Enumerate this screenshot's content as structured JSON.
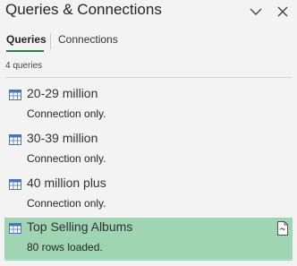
{
  "header": {
    "title": "Queries & Connections",
    "chevron_icon": "chevron-down-icon",
    "close_icon": "close-icon"
  },
  "tabs": [
    {
      "label": "Queries",
      "active": true
    },
    {
      "label": "Connections",
      "active": false
    }
  ],
  "query_count": "4 queries",
  "queries": [
    {
      "name": "20-29 million",
      "status": "Connection only.",
      "icon": "table-icon",
      "selected": false
    },
    {
      "name": "30-39 million",
      "status": "Connection only.",
      "icon": "table-icon",
      "selected": false
    },
    {
      "name": "40 million plus",
      "status": "Connection only.",
      "icon": "table-icon",
      "selected": false
    },
    {
      "name": "Top Selling Albums",
      "status": "80 rows loaded.",
      "icon": "table-icon",
      "selected": true,
      "action_icon": "document-icon"
    }
  ],
  "colors": {
    "accent": "#2f7d4f",
    "selected_row": "#9fd5b3",
    "table_icon": "#4a76b3",
    "background": "#f3f3f3"
  }
}
